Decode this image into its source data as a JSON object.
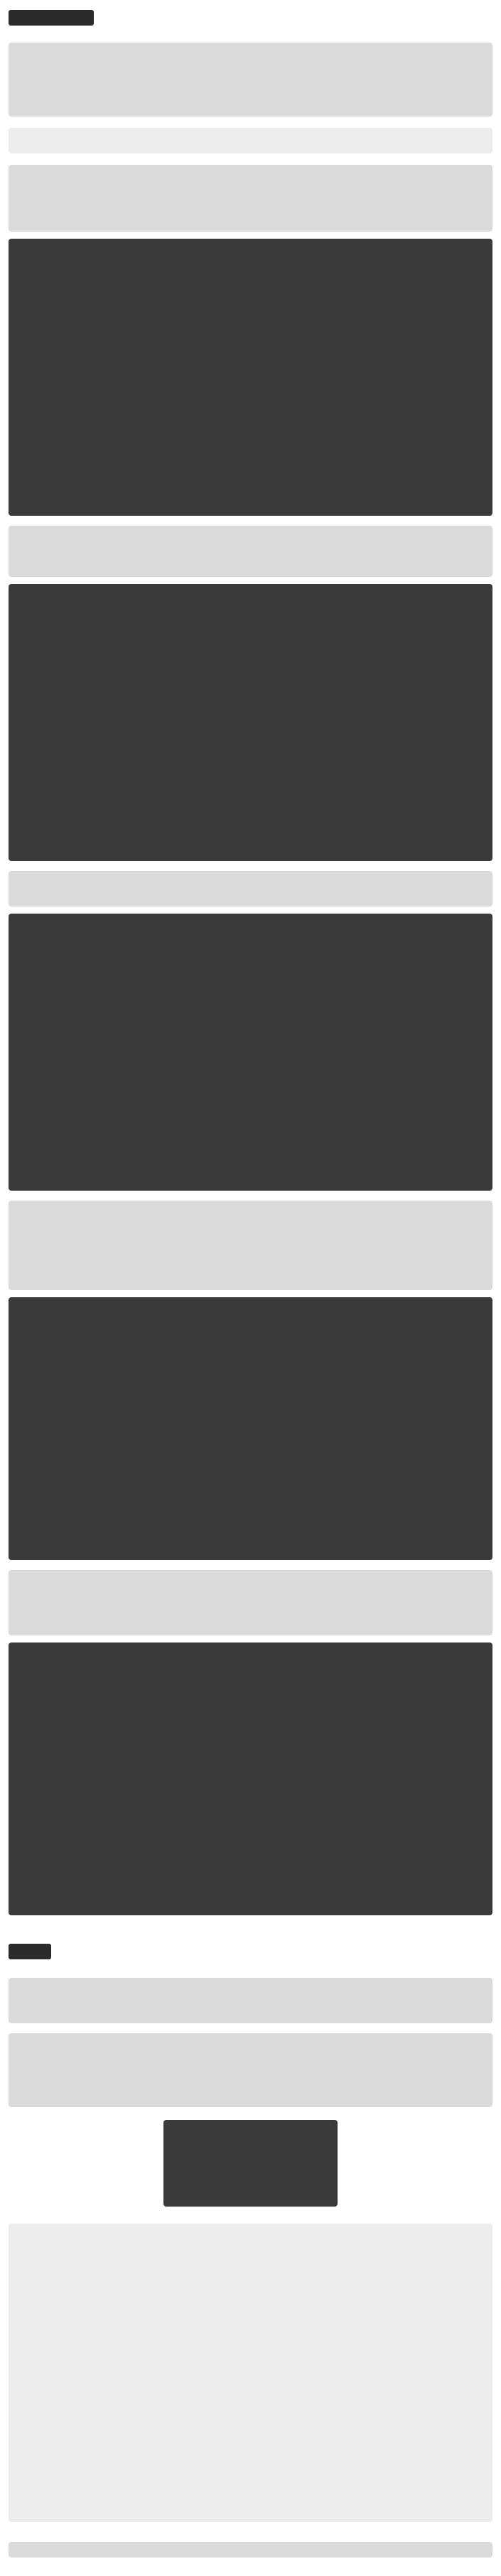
{
  "note_regions": []
}
